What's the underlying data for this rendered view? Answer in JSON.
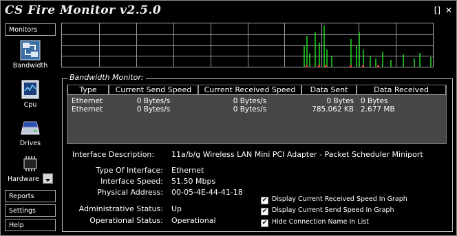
{
  "app": {
    "title": "CS Fire Monitor v2.5.0"
  },
  "window_controls": {
    "restore": "[]",
    "close": "✕"
  },
  "sidebar": {
    "monitors_label": "Monitors",
    "items": [
      {
        "label": "Bandwidth",
        "icon": "bandwidth-icon"
      },
      {
        "label": "Cpu",
        "icon": "cpu-icon"
      },
      {
        "label": "Drives",
        "icon": "drives-icon"
      },
      {
        "label": "Hardware",
        "icon": "hardware-icon"
      }
    ],
    "reports_label": "Reports",
    "settings_label": "Settings",
    "help_label": "Help"
  },
  "panel": {
    "title": "Bandwidth Monitor:"
  },
  "table": {
    "headers": [
      "Type",
      "Current Send Speed",
      "Current Received Speed",
      "Data Sent",
      "Data Received"
    ],
    "rows": [
      [
        "Ethernet",
        "0 Bytes/s",
        "0 Bytes/s",
        "0 Bytes",
        "0 Bytes"
      ],
      [
        "Ethernet",
        "0 Bytes/s",
        "0 Bytes/s",
        "785.062 KB",
        "2.677 MB"
      ]
    ]
  },
  "details": {
    "interface_description_label": "Interface Description:",
    "interface_description": "11a/b/g Wireless LAN Mini PCI Adapter - Packet Scheduler Miniport",
    "type_label": "Type Of Interface:",
    "type": "Ethernet",
    "speed_label": "Interface Speed:",
    "speed": "51.50 Mbps",
    "address_label": "Physical Address:",
    "address": "00-05-4E-44-41-18",
    "admin_label": "Administrative Status:",
    "admin": "Up",
    "oper_label": "Operational Status:",
    "oper": "Operational"
  },
  "options": [
    {
      "label": "Display Current Received Speed In Graph",
      "checked": true
    },
    {
      "label": "Display Current Send Speed In Graph",
      "checked": true
    },
    {
      "label": "Hide Connection Name In List",
      "checked": true
    }
  ],
  "colors": {
    "received_line": "#22dd22",
    "sent_line": "#ff3333",
    "grid": "#9a9a9a"
  }
}
